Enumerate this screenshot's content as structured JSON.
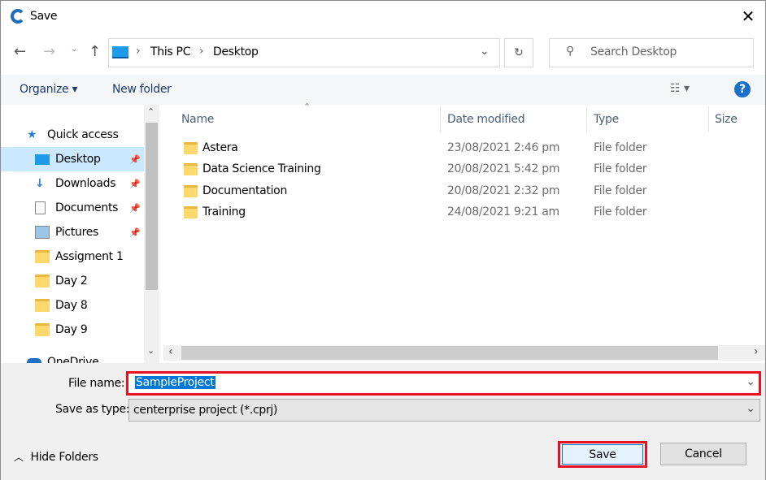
{
  "title": "Save",
  "address": {
    "crumbs": [
      "This PC",
      "Desktop"
    ]
  },
  "search": {
    "placeholder": "Search Desktop"
  },
  "toolbar": {
    "organize": "Organize",
    "new_folder": "New folder"
  },
  "nav": {
    "items": [
      {
        "label": "Quick access",
        "icon": "star-icon"
      },
      {
        "label": "Desktop",
        "icon": "desktop-icon",
        "pinned": true,
        "selected": true
      },
      {
        "label": "Downloads",
        "icon": "download-icon",
        "pinned": true
      },
      {
        "label": "Documents",
        "icon": "document-icon",
        "pinned": true
      },
      {
        "label": "Pictures",
        "icon": "pictures-icon",
        "pinned": true
      },
      {
        "label": "Assigment 1",
        "icon": "folder-icon"
      },
      {
        "label": "Day 2",
        "icon": "folder-icon"
      },
      {
        "label": "Day 8",
        "icon": "folder-icon"
      },
      {
        "label": "Day 9",
        "icon": "folder-icon"
      },
      {
        "label": "OneDrive",
        "icon": "cloud-icon"
      }
    ]
  },
  "columns": {
    "name": "Name",
    "date": "Date modified",
    "type": "Type",
    "size": "Size"
  },
  "files": [
    {
      "name": "Astera",
      "date": "23/08/2021 2:46 pm",
      "type": "File folder"
    },
    {
      "name": "Data Science Training",
      "date": "20/08/2021 5:42 pm",
      "type": "File folder"
    },
    {
      "name": "Documentation",
      "date": "20/08/2021 2:32 pm",
      "type": "File folder"
    },
    {
      "name": "Training",
      "date": "24/08/2021 9:21 am",
      "type": "File folder"
    }
  ],
  "form": {
    "file_name_label": "File name:",
    "file_name": "SampleProject",
    "type_label": "Save as type:",
    "type_value": "centerprise project (*.cprj)"
  },
  "footer": {
    "hide_folders": "Hide Folders",
    "save": "Save",
    "cancel": "Cancel"
  },
  "colors": {
    "highlight": "#e81123",
    "selection": "#0078d7",
    "nav_selected": "#cce8ff"
  }
}
